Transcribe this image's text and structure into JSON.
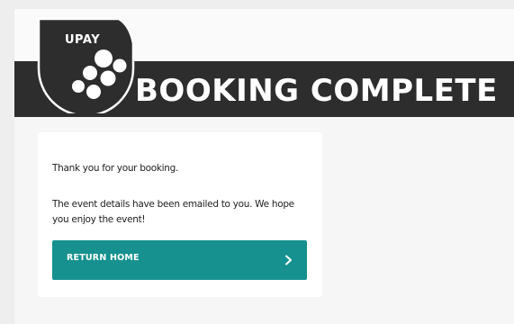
{
  "logo": {
    "text": "UPAY"
  },
  "header": {
    "title": "BOOKING COMPLETE"
  },
  "card": {
    "thanks": "Thank you for your booking.",
    "details": "The event details have been emailed to you. We hope you enjoy the event!",
    "return_label": "RETURN HOME"
  },
  "colors": {
    "header_bg": "#2d2d2d",
    "accent": "#16918f",
    "page_bg": "#f6f6f6",
    "card_bg": "#ffffff"
  },
  "icons": {
    "logo": "upay-logo-icon",
    "button": "chevron-right-icon"
  }
}
